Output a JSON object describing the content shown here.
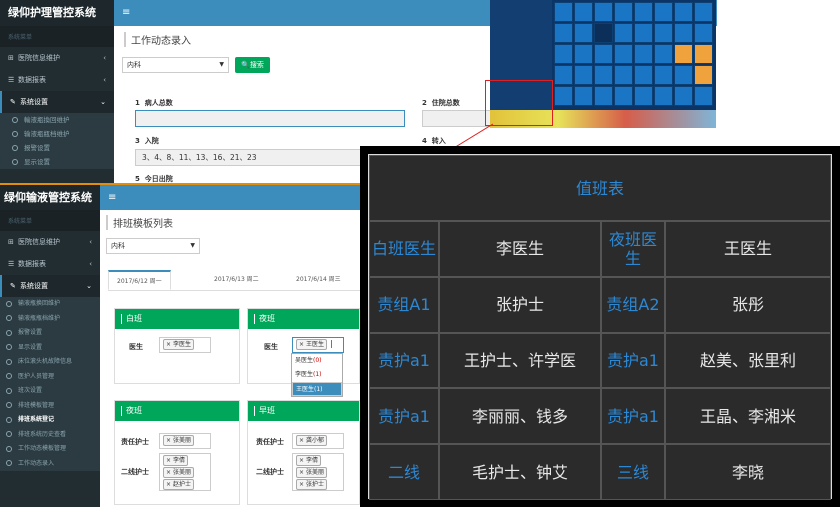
{
  "nursing_window": {
    "brand": "绿仰护理管控系统",
    "menu_icon": "≡",
    "sidebar_header": "系统菜单",
    "sidebar_items": [
      {
        "icon": "⊞",
        "label": "医院信息维护",
        "arrow": "‹"
      },
      {
        "icon": "☰",
        "label": "数据报表",
        "arrow": "‹"
      },
      {
        "icon": "✎",
        "label": "系统设置",
        "arrow": "⌄"
      }
    ],
    "sub_items": [
      "輸液瓶換回维护",
      "输液瓶瓶档维护",
      "报警设置",
      "显示设置"
    ],
    "page_title": "工作动态录入",
    "department_select": "内科",
    "search_button": "搜索",
    "fields": [
      {
        "num": "1",
        "label": "病人总数",
        "value": ""
      },
      {
        "num": "2",
        "label": "住院总数",
        "value": ""
      },
      {
        "num": "3",
        "label": "入院",
        "value": "3、4、8、11、13、16、21、23"
      },
      {
        "num": "4",
        "label": "转入",
        "value": ""
      },
      {
        "num": "5",
        "label": "今日出院",
        "value": ""
      }
    ]
  },
  "infusion_window": {
    "brand": "绿仰输液管控系统",
    "menu_icon": "≡",
    "sidebar_header": "系统菜单",
    "sidebar_items": [
      {
        "icon": "⊞",
        "label": "医院信息维护",
        "arrow": "‹"
      },
      {
        "icon": "☰",
        "label": "数据报表",
        "arrow": "‹"
      },
      {
        "icon": "✎",
        "label": "系统设置",
        "arrow": "⌄"
      }
    ],
    "sub_items": [
      "输液瓶换回维护",
      "输液瓶瓶档维护",
      "报警设置",
      "显示设置",
      "床位滚头机故障信息",
      "医护人员管理",
      "班次设置",
      "排班模板管理",
      "排班系统登记",
      "排班系统历史查看",
      "工作动态模板管理",
      "工作动态录入"
    ],
    "active_sub_index": 8,
    "page_title": "排班模板列表",
    "department_select": "内科",
    "tabs": [
      "2017/6/12 周一",
      "2017/6/13 周二",
      "2017/6/14 周三"
    ],
    "panels": {
      "day": {
        "title": "白班",
        "label": "医生",
        "tags": [
          "李医生"
        ]
      },
      "night": {
        "title": "夜班",
        "label": "医生",
        "tags": [
          "王医生"
        ]
      },
      "night2": {
        "title": "夜班",
        "rows": [
          {
            "label": "责任护士",
            "tags": [
              "张美丽"
            ]
          },
          {
            "label": "二线护士",
            "tags": [
              "李倩",
              "张美丽",
              "赵护士"
            ]
          }
        ]
      },
      "morning": {
        "title": "早班",
        "rows": [
          {
            "label": "责任护士",
            "tags": [
              "龚小郁"
            ]
          },
          {
            "label": "二线护士",
            "tags": [
              "李倩",
              "张美丽",
              "张护士"
            ]
          }
        ]
      }
    },
    "dropdown": [
      {
        "name": "吴医生",
        "count": "(0)"
      },
      {
        "name": "李医生",
        "count": "(1)"
      },
      {
        "name": "王医生",
        "count": "(1)"
      }
    ],
    "dropdown_selected": 2
  },
  "duty_table": {
    "title": "值班表",
    "rows": [
      {
        "l1": "白班医生",
        "v1": "李医生",
        "l2": "夜班医生",
        "v2": "王医生"
      },
      {
        "l1": "责组A1",
        "v1": "张护士",
        "l2": "责组A2",
        "v2": "张彤"
      },
      {
        "l1": "责护a1",
        "v1": "王护士、许学医",
        "l2": "责护a1",
        "v2": "赵美、张里利"
      },
      {
        "l1": "责护a1",
        "v1": "李丽丽、钱多",
        "l2": "责护a1",
        "v2": "王晶、李湘米"
      },
      {
        "l1": "二线",
        "v1": "毛护士、钟艾",
        "l2": "三线",
        "v2": "李晓"
      }
    ]
  },
  "colors": {
    "sidebar": "#222d32",
    "topbar": "#3c8dbc",
    "green": "#00a65a",
    "accent_blue": "#2d88d4",
    "callout_red": "#e02020"
  }
}
